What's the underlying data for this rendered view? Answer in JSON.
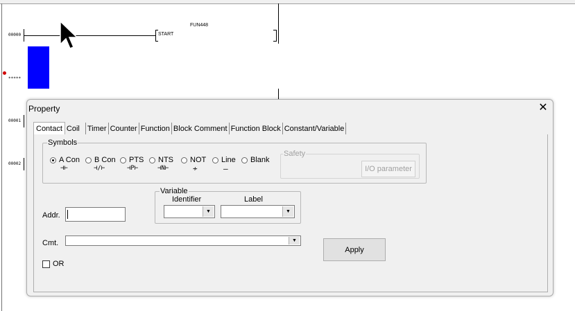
{
  "ladder": {
    "rungs": [
      "00000",
      "*****",
      "00001",
      "00002"
    ],
    "function_name": "FUN448",
    "function_label": "START"
  },
  "dialog": {
    "title": "Property",
    "close_glyph": "✕",
    "tabs": [
      "Contact",
      "Coil",
      "Timer",
      "Counter",
      "Function",
      "Block Comment",
      "Function Block",
      "Constant/Variable"
    ],
    "active_tab": "Contact",
    "symbols": {
      "legend": "Symbols",
      "options": [
        {
          "label": "A Con",
          "glyph": "⊣⊢",
          "selected": true
        },
        {
          "label": "B Con",
          "glyph": "⊣/⊢",
          "selected": false
        },
        {
          "label": "PTS",
          "glyph": "⊣P⊢",
          "selected": false
        },
        {
          "label": "NTS",
          "glyph": "⊣N⊢",
          "selected": false
        },
        {
          "label": "NOT",
          "glyph": "≁",
          "selected": false
        },
        {
          "label": "Line",
          "glyph": "—",
          "selected": false
        },
        {
          "label": "Blank",
          "glyph": "",
          "selected": false
        }
      ]
    },
    "safety": {
      "legend": "Safety",
      "io_button": "I/O parameter"
    },
    "variable": {
      "legend": "Variable",
      "identifier_label": "Identifier",
      "label_label": "Label",
      "identifier_value": "",
      "label_value": ""
    },
    "addr": {
      "label": "Addr.",
      "value": ""
    },
    "cmt": {
      "label": "Cmt.",
      "value": ""
    },
    "or_checkbox": {
      "label": "OR",
      "checked": false
    },
    "apply_button": "Apply"
  }
}
